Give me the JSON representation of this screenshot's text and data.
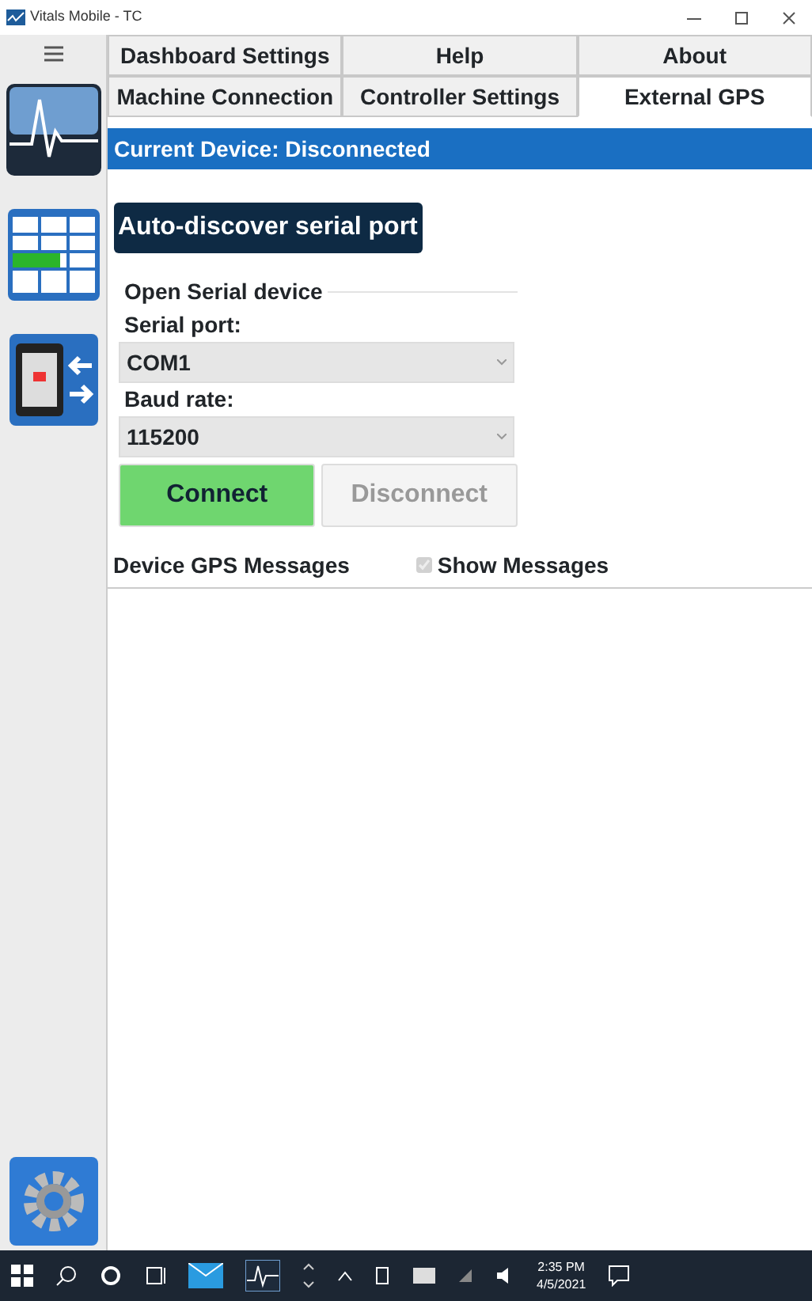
{
  "window": {
    "title": "Vitals Mobile - TC"
  },
  "tab_rows": [
    [
      {
        "label": "Dashboard Settings",
        "selected": false
      },
      {
        "label": "Help",
        "selected": false
      },
      {
        "label": "About",
        "selected": false
      }
    ],
    [
      {
        "label": "Machine Connection",
        "selected": false
      },
      {
        "label": "Controller Settings",
        "selected": false
      },
      {
        "label": "External GPS",
        "selected": true
      }
    ]
  ],
  "status_bar": "Current Device: Disconnected",
  "auto_discover_button": "Auto-discover serial port",
  "serial_group": {
    "legend": "Open Serial device",
    "fields": [
      {
        "label": "Serial port:",
        "value": "COM1"
      },
      {
        "label": "Baud rate:",
        "value": "115200"
      }
    ],
    "buttons": [
      {
        "label": "Connect",
        "kind": "primary",
        "disabled": false
      },
      {
        "label": "Disconnect",
        "kind": "plain",
        "disabled": true
      }
    ]
  },
  "messages": {
    "label": "Device GPS Messages",
    "checkbox": {
      "label": "Show Messages",
      "checked": true
    }
  },
  "taskbar": {
    "time": "2:35 PM",
    "date": "4/5/2021"
  }
}
